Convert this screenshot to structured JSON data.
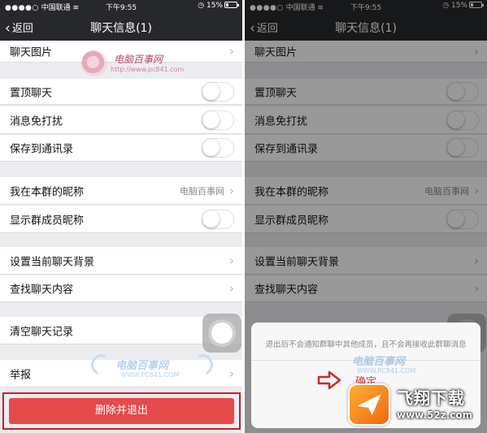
{
  "status": {
    "carrier": "中国联通",
    "time": "下午9:55",
    "battery": "15%"
  },
  "nav": {
    "back": "返回",
    "title": "聊天信息(1)"
  },
  "rows": {
    "photos": "聊天图片",
    "pin": "置顶聊天",
    "mute": "消息免打扰",
    "save_contacts": "保存到通讯录",
    "my_nickname": "我在本群的昵称",
    "my_nickname_value": "电脑百事网",
    "show_nicknames": "显示群成员昵称",
    "set_background": "设置当前聊天背景",
    "search_content": "查找聊天内容",
    "clear_history": "清空聊天记录",
    "report": "举报"
  },
  "toggles": {
    "pin": false,
    "mute": false,
    "save_contacts": false,
    "show_nicknames": false
  },
  "delete_exit_label": "删除并退出",
  "dialog": {
    "message": "退出后不会通知群聊中其他成员，且不会再接收此群聊消息",
    "confirm": "确定"
  },
  "watermark_top": {
    "name": "电脑百事网",
    "url": "http://www.pc841.com"
  },
  "watermark_bottom": {
    "name": "电脑百事网",
    "url": "WWW.PC841.COM"
  },
  "brand": {
    "name": "飞翔下载",
    "url": "www.52z.com"
  },
  "colors": {
    "nav_bg": "#27282c",
    "danger": "#e44a4a",
    "highlight": "#c91e26",
    "confirm": "#e0393e"
  }
}
